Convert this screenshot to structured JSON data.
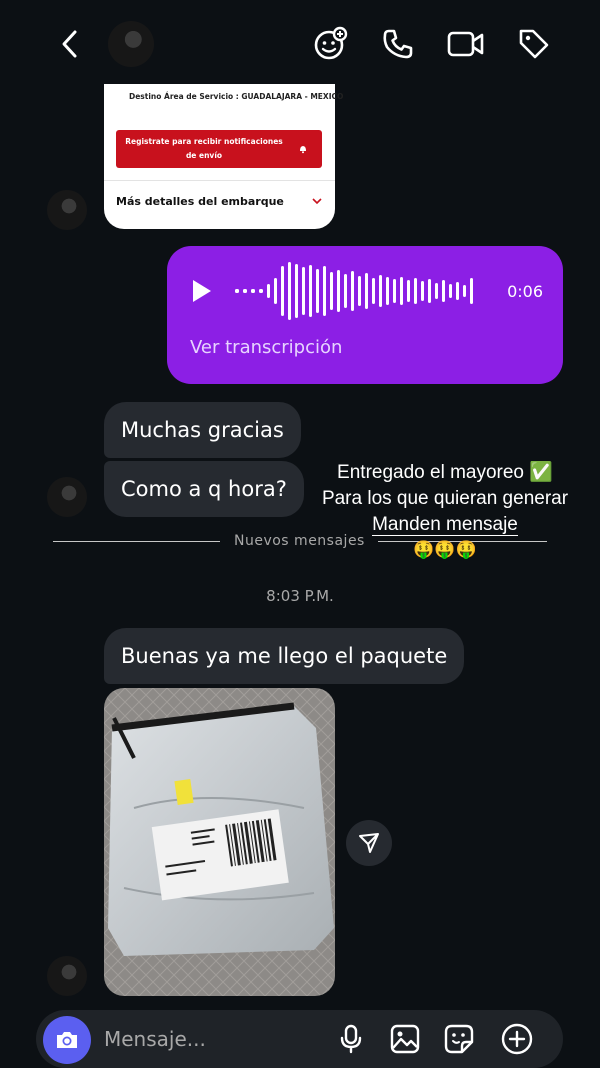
{
  "header": {
    "back_label": "back",
    "actions": [
      "video-effects-icon",
      "phone-icon",
      "video-icon",
      "tag-icon"
    ]
  },
  "shared_card": {
    "destination": "Destino Área de Servicio : GUADALAJARA - MEXICO",
    "notify_button": "Registrate para recibir notificaciones de envío",
    "more_details": "Más detalles del embarque"
  },
  "voice_message": {
    "duration": "0:06",
    "transcription_link": "Ver transcripción",
    "color": "#8c1fe5"
  },
  "messages": [
    {
      "text": "Muchas gracias"
    },
    {
      "text": "Como a q hora?"
    },
    {
      "text": "Buenas ya me llego el paquete"
    }
  ],
  "divider": {
    "label": "Nuevos mensajes"
  },
  "timestamp": "8:03 P.M.",
  "overlay_caption": {
    "line1": "Entregado el mayoreo ✅",
    "line2": "Para los que quieran generar",
    "line3": "Manden mensaje",
    "emojis": "🤑🤑🤑"
  },
  "composer": {
    "placeholder": "Mensaje...",
    "accent": "#5b5ff0"
  }
}
